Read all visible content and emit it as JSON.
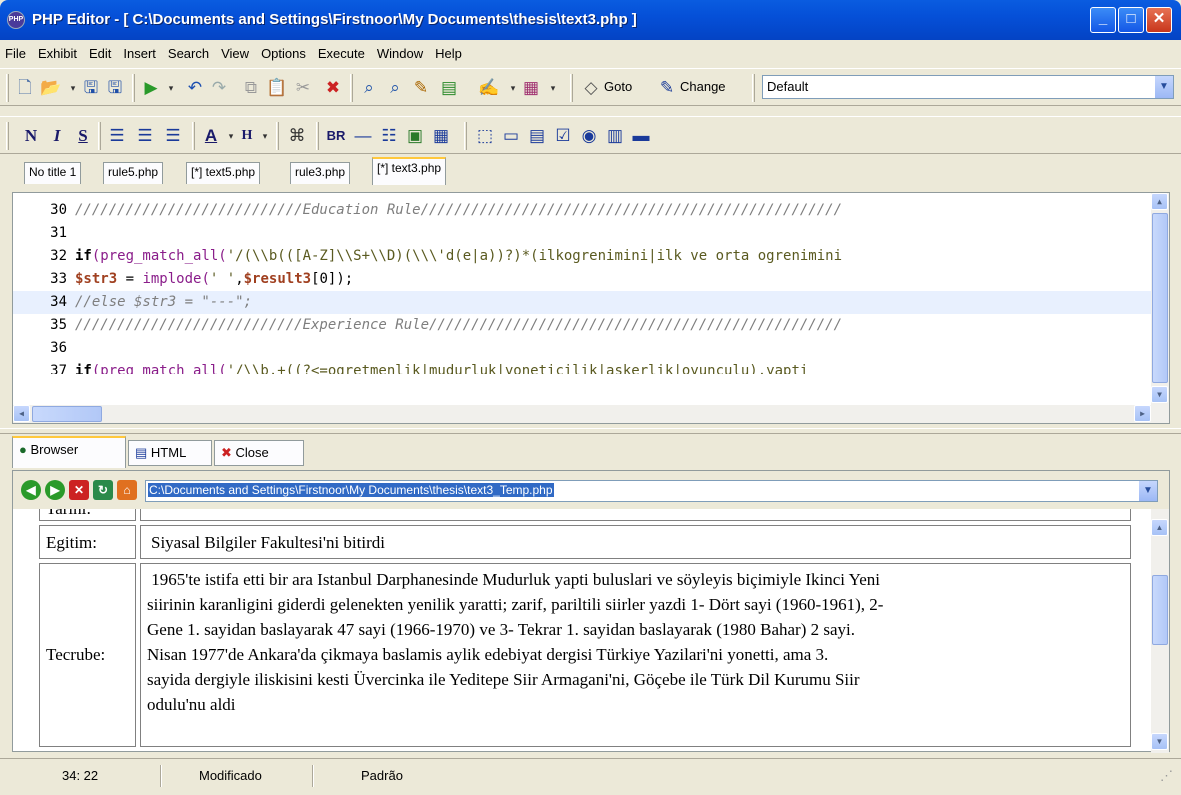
{
  "window": {
    "title": "PHP Editor - [ C:\\Documents and Settings\\Firstnoor\\My Documents\\thesis\\text3.php ]",
    "app_icon": "PHP",
    "minimize": "_",
    "maximize": "□",
    "close": "✕"
  },
  "menu": [
    "File",
    "Exhibit",
    "Edit",
    "Insert",
    "Search",
    "View",
    "Options",
    "Execute",
    "Window",
    "Help"
  ],
  "toolbar1": {
    "goto_label": "Goto",
    "change_label": "Change",
    "style_select": "Default"
  },
  "toolbar2": {
    "bold": "N",
    "italic": "I",
    "underline": "S",
    "heading": "H",
    "br": "BR"
  },
  "tabs": [
    "No title 1",
    "rule5.php",
    "[*] text5.php",
    "rule3.php",
    "[*] text3.php"
  ],
  "editor": {
    "lines": [
      {
        "num": "30",
        "text": "///////////////////////////Education Rule//////////////////////////////////////////////////"
      },
      {
        "num": "31",
        "text": ""
      },
      {
        "num": "32",
        "kw": "if",
        "fn": "(preg_match_all(",
        "str": "'/(\\\\b(([A-Z]\\\\S+\\\\D)(\\\\\\'d(e|a))?)*(ilkogrenimini|ilk ve orta ogrenimini"
      },
      {
        "num": "33",
        "var": "$str3",
        "rest": " = ",
        "fn": "implode(",
        "str": "' '",
        "rest2": ",",
        "var2": "$result3",
        "rest3": "[0]);"
      },
      {
        "num": "34",
        "text": "//else $str3 = \"---\";"
      },
      {
        "num": "35",
        "text": "///////////////////////////Experience Rule/////////////////////////////////////////////////"
      },
      {
        "num": "36",
        "text": ""
      },
      {
        "num": "37",
        "kw": "if",
        "fn": "(preg_match_all(",
        "str": "'/\\\\b.+((?<=ogretmenlik|mudurluk|yoneticilik|askerlik|oyunculu).yapti"
      }
    ]
  },
  "bottom_tabs": [
    "Browser",
    "HTML",
    "Close"
  ],
  "browser": {
    "address": "C:\\Documents and Settings\\Firstnoor\\My Documents\\thesis\\text3_Temp.php",
    "rows": [
      {
        "label": "Tarihi:",
        "value": ""
      },
      {
        "label": "Egitim:",
        "value": "Siyasal Bilgiler Fakultesi'ni bitirdi"
      },
      {
        "label": "Tecrube:",
        "value_lines": [
          " 1965'te istifa etti bir ara Istanbul Darphanesinde Mudurluk yapti buluslari ve söyleyis biçimiyle Ikinci Yeni",
          "siirinin karanligini giderdi gelenekten yenilik yaratti; zarif, pariltili siirler yazdi 1- Dört sayi (1960-1961), 2-",
          "Gene 1. sayidan baslayarak 47 sayi (1966-1970) ve 3- Tekrar 1. sayidan baslayarak (1980 Bahar) 2 sayi.",
          "Nisan 1977'de Ankara'da çikmaya baslamis aylik edebiyat dergisi Türkiye Yazilari'ni yonetti, ama 3.",
          "sayida dergiyle iliskisini kesti Üvercinka ile Yeditepe Siir Armagani'ni, Göçebe ile Türk Dil Kurumu Siir",
          "odulu'nu aldi"
        ]
      }
    ]
  },
  "status": {
    "position": "34: 22",
    "modified": "Modificado",
    "mode": "Padrão"
  }
}
